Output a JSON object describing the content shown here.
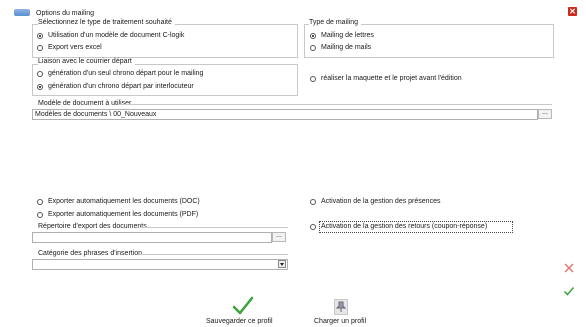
{
  "window": {
    "title": "Options du mailing",
    "close_symbol": "✕"
  },
  "traitement": {
    "title": "Sélectionnez le type de traitement souhaité",
    "options": [
      "Utilisation d'un modèle de document C-logik",
      "Export vers excel"
    ],
    "selected": 0
  },
  "type_mailing": {
    "title": "Type de mailing",
    "options": [
      "Mailing de lettres",
      "Mailing de mails"
    ],
    "selected": 0
  },
  "liaison": {
    "title": "Liaison avec le courrier départ",
    "options": [
      "génération d'un seul chrono départ pour le mailing",
      "génération d'un chrono départ par interlocuteur"
    ],
    "selected": 1
  },
  "maquette": {
    "label": "réaliser la maquette et le projet avant l'édition",
    "checked": false
  },
  "modele": {
    "title": "Modèle de document à utiliser",
    "value": "Modèles de documents \\ 00_Nouveaux",
    "browse_label": "..."
  },
  "export_doc": {
    "label": "Exporter automatiquement les documents (DOC)",
    "checked": false
  },
  "export_pdf": {
    "label": "Exporter automatiquement les documents (PDF)",
    "checked": false
  },
  "presences": {
    "label": "Activation de la gestion des présences",
    "checked": false
  },
  "retours": {
    "label": "Activation de la gestion des retours (coupon-réponse)",
    "checked": false
  },
  "repertoire": {
    "title": "Répertoire d'export des documents",
    "value": "",
    "browse_label": "..."
  },
  "categorie": {
    "title": "Catégorie des phrases d'insertion",
    "value": ""
  },
  "actions": {
    "save_label": "Sauvegarder ce profil",
    "load_label": "Charger un profil",
    "save_icon": "checkmark-icon",
    "load_icon": "pin-icon"
  },
  "side": {
    "cancel_icon": "x-icon",
    "ok_icon": "check-icon"
  },
  "colors": {
    "accent_red": "#cc2a1c",
    "check_green": "#3aa43a",
    "cancel_red": "#e07a70"
  }
}
